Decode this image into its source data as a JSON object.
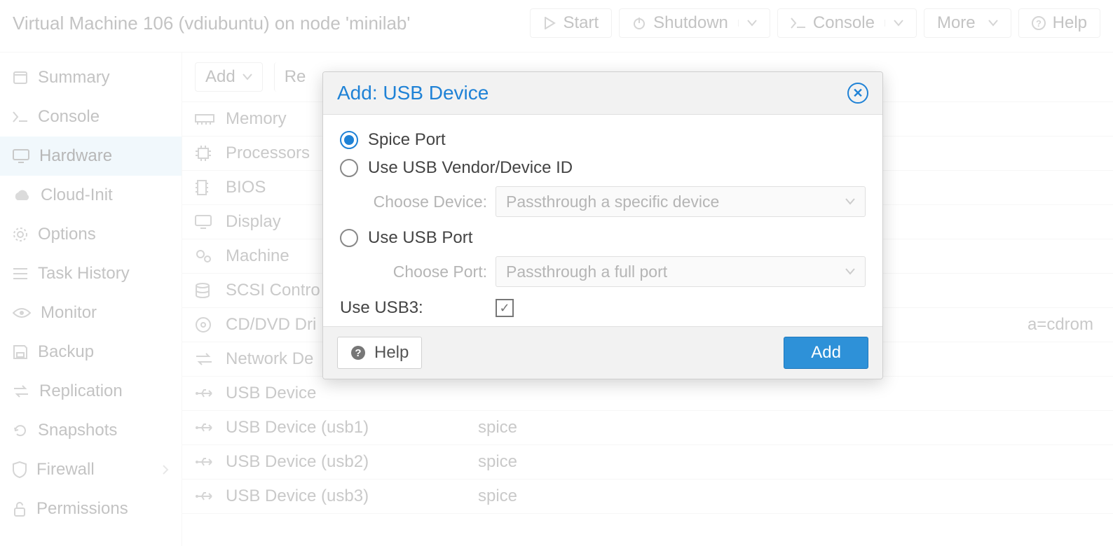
{
  "header": {
    "title": "Virtual Machine 106 (vdiubuntu) on node 'minilab'",
    "start": "Start",
    "shutdown": "Shutdown",
    "console": "Console",
    "more": "More",
    "help": "Help"
  },
  "sidebar": {
    "items": [
      {
        "label": "Summary"
      },
      {
        "label": "Console"
      },
      {
        "label": "Hardware"
      },
      {
        "label": "Cloud-Init"
      },
      {
        "label": "Options"
      },
      {
        "label": "Task History"
      },
      {
        "label": "Monitor"
      },
      {
        "label": "Backup"
      },
      {
        "label": "Replication"
      },
      {
        "label": "Snapshots"
      },
      {
        "label": "Firewall"
      },
      {
        "label": "Permissions"
      }
    ]
  },
  "toolbar": {
    "add": "Add",
    "remove": "Re"
  },
  "hardware": {
    "rows": [
      {
        "name": "Memory",
        "value": ""
      },
      {
        "name": "Processors",
        "value": ""
      },
      {
        "name": "BIOS",
        "value": ""
      },
      {
        "name": "Display",
        "value": ""
      },
      {
        "name": "Machine",
        "value": ""
      },
      {
        "name": "SCSI Contro",
        "value": ""
      },
      {
        "name": "CD/DVD Dri",
        "value": "a=cdrom"
      },
      {
        "name": "Network De",
        "value": ""
      },
      {
        "name": "USB Device",
        "value": ""
      },
      {
        "name": "USB Device (usb1)",
        "value": "spice"
      },
      {
        "name": "USB Device (usb2)",
        "value": "spice"
      },
      {
        "name": "USB Device (usb3)",
        "value": "spice"
      }
    ]
  },
  "dialog": {
    "title": "Add: USB Device",
    "opt_spice": "Spice Port",
    "opt_vendor": "Use USB Vendor/Device ID",
    "choose_device_label": "Choose Device:",
    "choose_device_placeholder": "Passthrough a specific device",
    "opt_port": "Use USB Port",
    "choose_port_label": "Choose Port:",
    "choose_port_placeholder": "Passthrough a full port",
    "usb3_label": "Use USB3:",
    "help": "Help",
    "add": "Add"
  }
}
